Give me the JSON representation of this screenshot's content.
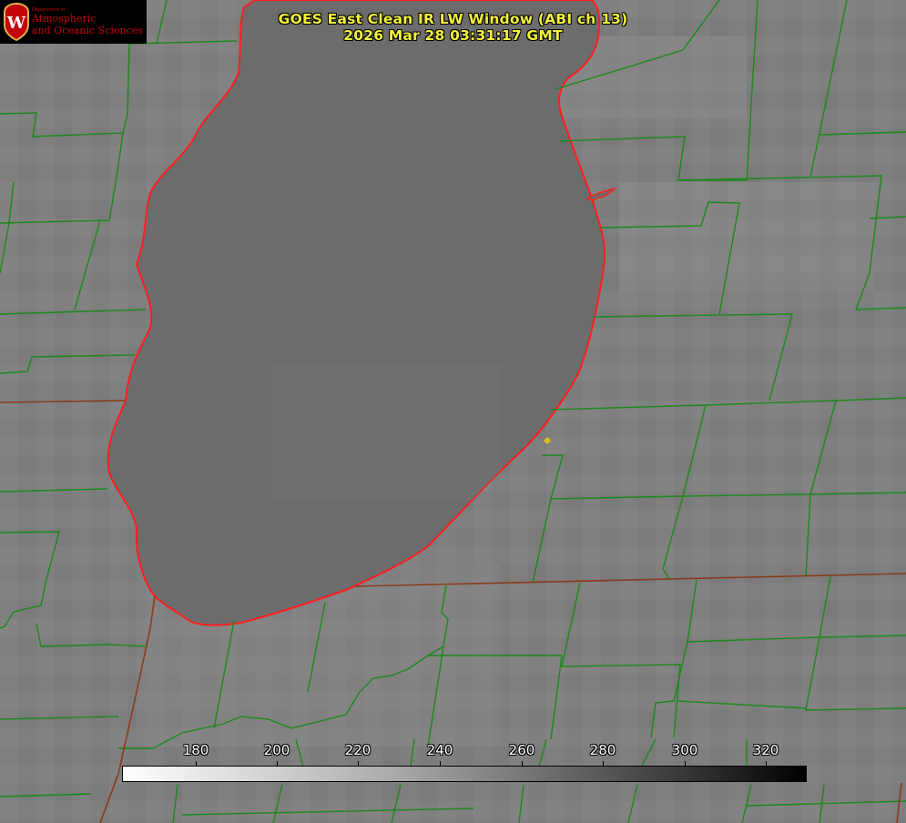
{
  "header": {
    "title_line1": "GOES East Clean IR LW Window (ABI ch 13)",
    "title_line2": "2026 Mar 28 03:31:17 GMT"
  },
  "logo": {
    "badge_letter": "W",
    "dept_text": "Department of",
    "line1": "Atmospheric",
    "line2": "and Oceanic Sciences"
  },
  "colorbar": {
    "ticks": [
      "180",
      "200",
      "220",
      "240",
      "260",
      "280",
      "300",
      "320"
    ],
    "colors": {
      "low": "#ffffff",
      "high": "#000000"
    }
  },
  "map": {
    "background_color": "#7e7e7e",
    "lake_color": "#6b6b6b",
    "county_line_color": "#1a8a1a",
    "state_line_color": "#8b3a1a",
    "coastline_color": "#ff1e1e",
    "marker_color": "#d4c21a"
  }
}
